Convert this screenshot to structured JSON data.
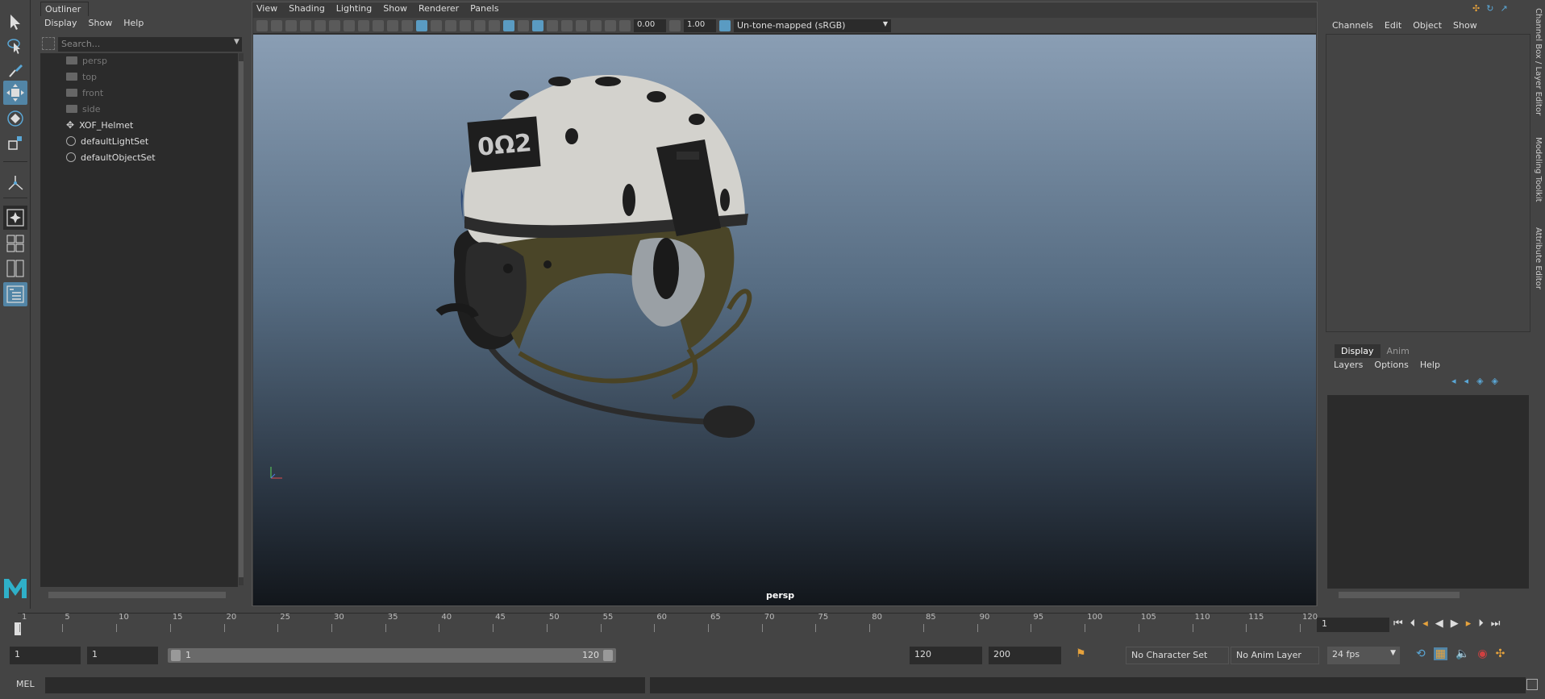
{
  "outliner": {
    "tab": "Outliner",
    "menu": [
      "Display",
      "Show",
      "Help"
    ],
    "search_placeholder": "Search...",
    "items": [
      {
        "label": "persp",
        "dim": true
      },
      {
        "label": "top",
        "dim": true
      },
      {
        "label": "front",
        "dim": true
      },
      {
        "label": "side",
        "dim": true
      },
      {
        "label": "XOF_Helmet",
        "dim": false
      },
      {
        "label": "defaultLightSet",
        "dim": false
      },
      {
        "label": "defaultObjectSet",
        "dim": false
      }
    ]
  },
  "viewport": {
    "menu": [
      "View",
      "Shading",
      "Lighting",
      "Show",
      "Renderer",
      "Panels"
    ],
    "exposure": "0.00",
    "gamma": "1.00",
    "tone_map": "Un-tone-mapped (sRGB)",
    "camera_label": "persp",
    "helmet_patch_text": "0Ω2"
  },
  "channel_box": {
    "menu": [
      "Channels",
      "Edit",
      "Object",
      "Show"
    ],
    "tabs": [
      "Display",
      "Anim"
    ],
    "layer_menu": [
      "Layers",
      "Options",
      "Help"
    ]
  },
  "side_tabs": [
    "Channel Box / Layer Editor",
    "Modeling Toolkit",
    "Attribute Editor"
  ],
  "timeline": {
    "ticks": [
      "1",
      "5",
      "10",
      "15",
      "20",
      "25",
      "30",
      "35",
      "40",
      "45",
      "50",
      "55",
      "60",
      "65",
      "70",
      "75",
      "80",
      "85",
      "90",
      "95",
      "100",
      "105",
      "110",
      "115",
      "120"
    ],
    "current_frame": "1"
  },
  "range": {
    "start": "1",
    "playback_start": "1",
    "slider_start": "1",
    "slider_end": "120",
    "playback_end": "120",
    "end": "200",
    "character_set": "No Character Set",
    "anim_layer": "No Anim Layer",
    "fps": "24 fps"
  },
  "command_line": {
    "label": "MEL"
  },
  "colors": {
    "accent": "#5285a6",
    "panel": "#444444",
    "field": "#2b2b2b",
    "logo": "#2fb0c8"
  }
}
